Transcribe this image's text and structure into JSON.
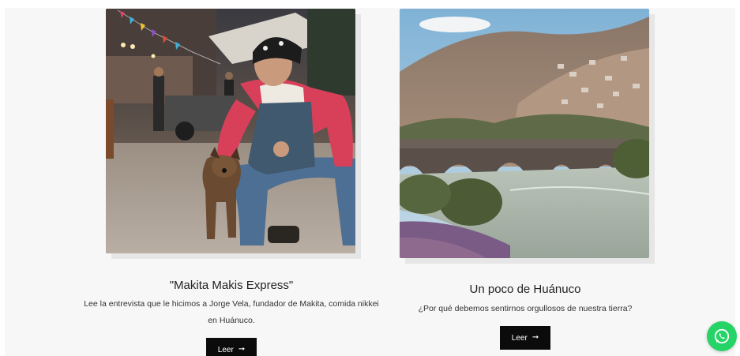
{
  "colors": {
    "accent_button": "#0b0b0b",
    "whatsapp": "#25d366"
  },
  "posts": [
    {
      "title": "\"Makita Makis Express\"",
      "description": "Lee la entrevista que le hicimos a Jorge Vela, fundador de Makita, comida nikkei en Huánuco.",
      "button_label": "Leer",
      "button_icon": "arrow-right-icon",
      "image_alt": "man-crouching-with-dog-photo"
    },
    {
      "title": "Un poco de Huánuco",
      "description": "¿Por qué debemos sentirnos orgullosos de nuestra tierra?",
      "button_label": "Leer",
      "button_icon": "arrow-right-icon",
      "image_alt": "huanuco-bridge-river-photo"
    }
  ],
  "floating": {
    "icon": "whatsapp-icon"
  }
}
